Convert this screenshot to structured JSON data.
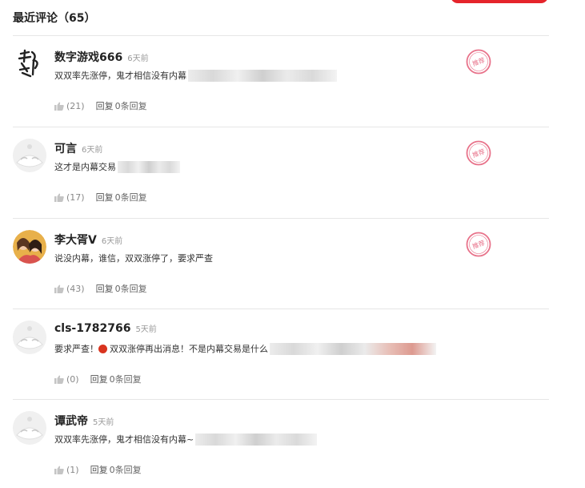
{
  "header": {
    "title": "最近评论（65）"
  },
  "stamp_label": "推荐",
  "colors": {
    "accent": "#e5242b",
    "stamp": "#e8728a"
  },
  "comments": [
    {
      "name": "数字游戏666",
      "time": "6天前",
      "text": "双双率先涨停，鬼才相信没有内幕",
      "likes": "(21)",
      "reply_label": "回复",
      "reply_count": "0条回复",
      "avatar": "calligraphy",
      "recommended": true
    },
    {
      "name": "可言",
      "time": "6天前",
      "text": "这才是内幕交易",
      "likes": "(17)",
      "reply_label": "回复",
      "reply_count": "0条回复",
      "avatar": "default",
      "recommended": true
    },
    {
      "name": "李大胥V",
      "time": "6天前",
      "text": "说没内幕，谁信，双双涨停了，要求严查",
      "likes": "(43)",
      "reply_label": "回复",
      "reply_count": "0条回复",
      "avatar": "photo",
      "recommended": true
    },
    {
      "name": "cls-1782766",
      "time": "5天前",
      "text": "要求严查！",
      "text2": "双双涨停再出消息！不是内幕交易是什么",
      "likes": "(0)",
      "reply_label": "回复",
      "reply_count": "0条回复",
      "avatar": "default",
      "recommended": false
    },
    {
      "name": "谭武帝",
      "time": "5天前",
      "text": "双双率先涨停，鬼才相信没有内幕~",
      "likes": "(1)",
      "reply_label": "回复",
      "reply_count": "0条回复",
      "avatar": "default",
      "recommended": false
    }
  ]
}
